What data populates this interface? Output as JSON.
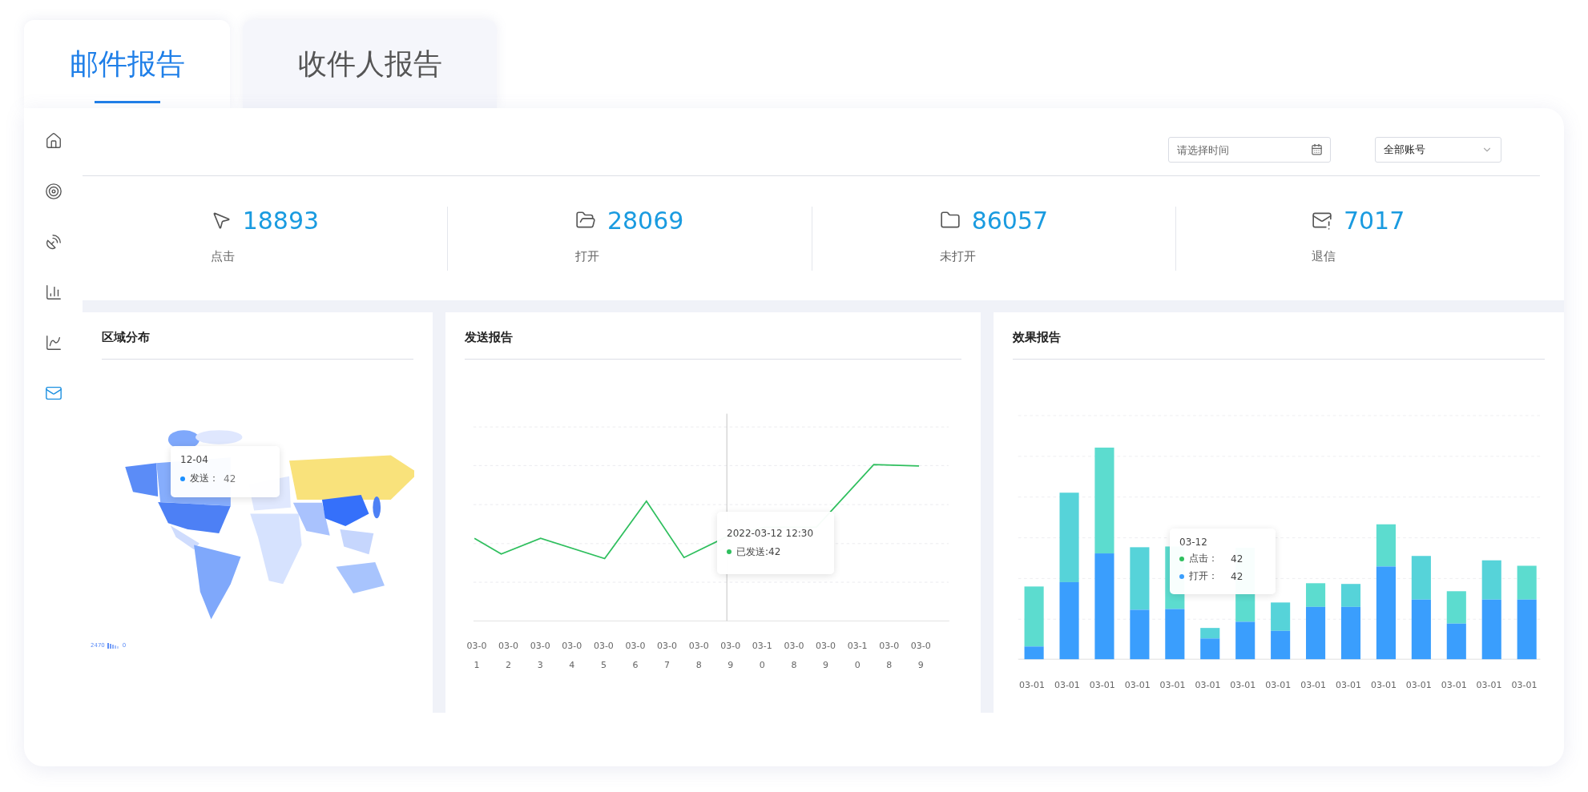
{
  "tabs": [
    {
      "label": "邮件报告",
      "selected": true
    },
    {
      "label": "收件人报告",
      "selected": false
    }
  ],
  "sidebar": {
    "items": [
      {
        "kind": "home",
        "selected": false
      },
      {
        "kind": "target",
        "selected": false
      },
      {
        "kind": "dish",
        "selected": false
      },
      {
        "kind": "bars",
        "selected": false
      },
      {
        "kind": "chart-search",
        "selected": false
      },
      {
        "kind": "mail",
        "selected": true
      }
    ]
  },
  "toolbar": {
    "date": {
      "placeholder": "请选择时间"
    },
    "account": {
      "value": "全部账号"
    }
  },
  "stats": [
    {
      "kind": "click",
      "value": "18893",
      "label": "点击"
    },
    {
      "kind": "open",
      "value": "28069",
      "label": "打开"
    },
    {
      "kind": "unopened",
      "value": "86057",
      "label": "未打开"
    },
    {
      "kind": "bounce",
      "value": "7017",
      "label": "退信"
    }
  ],
  "region_panel": {
    "title": "区域分布",
    "tooltip": {
      "date": "12-04",
      "label": "发送：",
      "value": "42"
    },
    "legend_max": "2470",
    "legend_min": "0"
  },
  "send_panel": {
    "title": "发送报告",
    "x_labels": [
      "03-01",
      "03-02",
      "03-03",
      "03-04",
      "03-05",
      "03-06",
      "03-07",
      "03-08",
      "03-09",
      "03-10",
      "03-08",
      "03-09",
      "03-10",
      "03-08",
      "03-09"
    ],
    "tooltip": {
      "time": "2022-03-12 12:30",
      "label": "已发送:42"
    }
  },
  "effect_panel": {
    "title": "效果报告",
    "x_labels": [
      "03-01",
      "03-01",
      "03-01",
      "03-01",
      "03-01",
      "03-01",
      "03-01",
      "03-01",
      "03-01",
      "03-01",
      "03-01",
      "03-01",
      "03-01",
      "03-01",
      "03-01"
    ],
    "tooltip": {
      "date": "03-12",
      "rows": [
        {
          "label": "点击：",
          "value": "42",
          "color": "#2fbf5e"
        },
        {
          "label": "打开：",
          "value": "42",
          "color": "#3a9efd"
        }
      ]
    }
  }
}
